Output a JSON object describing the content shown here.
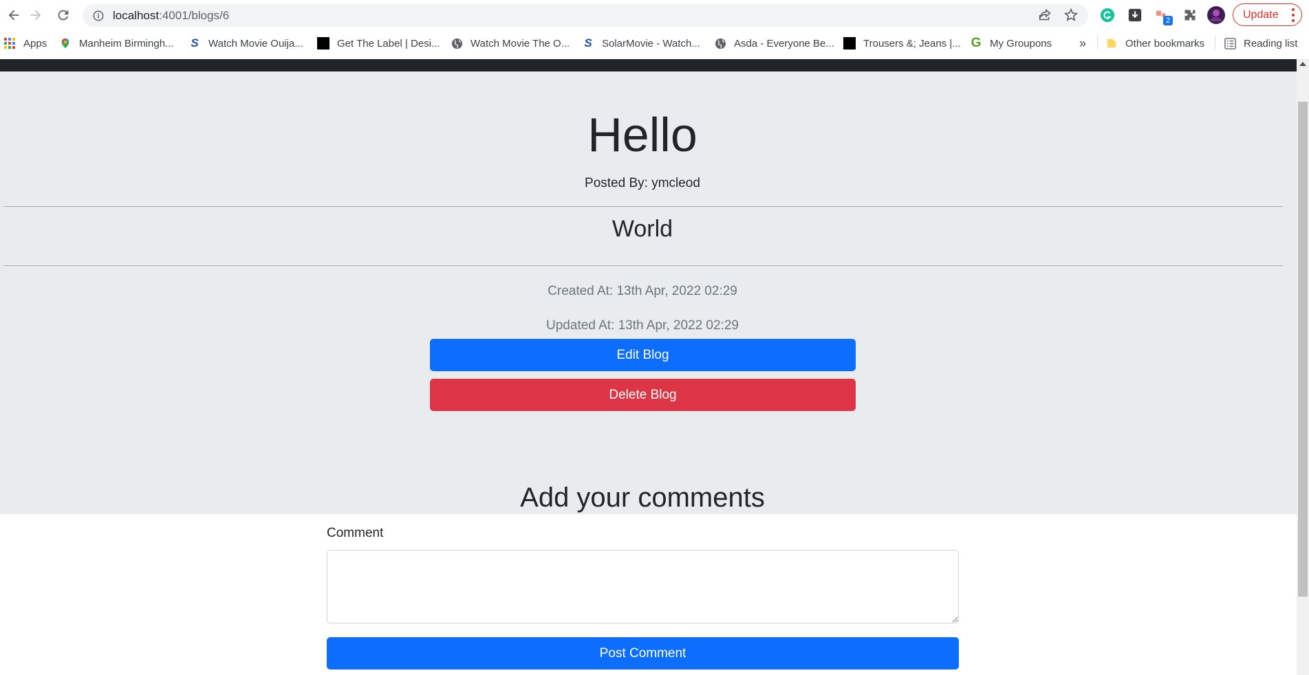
{
  "browser": {
    "url_host": "localhost",
    "url_path": ":4001/blogs/6",
    "update_label": "Update",
    "extension_badge": "2"
  },
  "bookmarks": {
    "items": [
      {
        "label": "Apps",
        "icon": "apps-grid-icon"
      },
      {
        "label": "Manheim Birmingh...",
        "icon": "maps-pin-icon"
      },
      {
        "label": "Watch Movie Ouija...",
        "icon": "s-logo-icon"
      },
      {
        "label": "Get The Label | Desi...",
        "icon": "label-logo-icon"
      },
      {
        "label": "Watch Movie The O...",
        "icon": "globe-icon"
      },
      {
        "label": "SolarMovie - Watch...",
        "icon": "s-logo-icon"
      },
      {
        "label": "Asda - Everyone Be...",
        "icon": "globe-icon"
      },
      {
        "label": "Trousers &; Jeans |...",
        "icon": "label-logo-icon"
      },
      {
        "label": "My Groupons",
        "icon": "groupon-icon"
      }
    ],
    "overflow": "»",
    "other_bookmarks": "Other bookmarks",
    "reading_list": "Reading list"
  },
  "blog": {
    "title": "Hello",
    "posted_by": "Posted By: ymcleod",
    "body": "World",
    "created_at": "Created At: 13th Apr, 2022 02:29",
    "updated_at": "Updated At: 13th Apr, 2022 02:29",
    "edit_label": "Edit Blog",
    "delete_label": "Delete Blog"
  },
  "comments": {
    "heading": "Add your comments",
    "label": "Comment",
    "value": "",
    "submit_label": "Post Comment"
  },
  "colors": {
    "primary": "#0d6efd",
    "danger": "#dc3545",
    "jumbotron": "#e9ecef",
    "navbar": "#212529",
    "update_red": "#d93025"
  }
}
